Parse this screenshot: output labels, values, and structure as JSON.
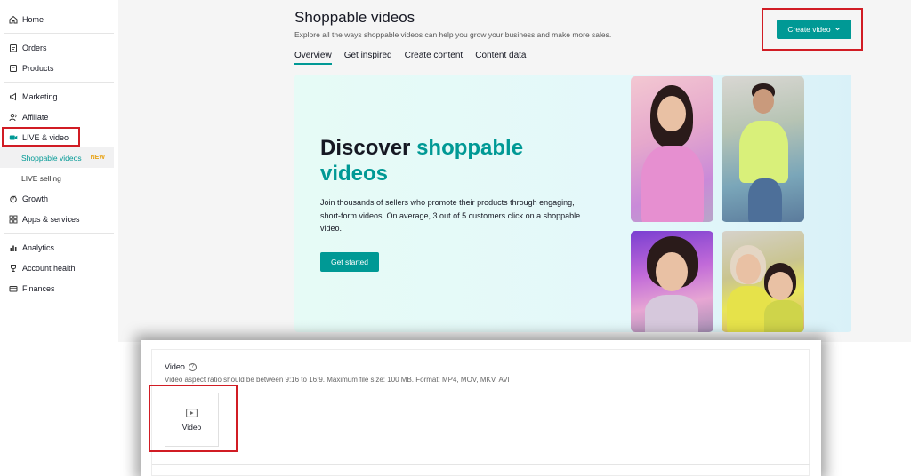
{
  "sidebar": {
    "items": [
      {
        "label": "Home",
        "icon": "home-icon"
      },
      {
        "label": "Orders",
        "icon": "clipboard-icon"
      },
      {
        "label": "Products",
        "icon": "box-icon"
      },
      {
        "label": "Marketing",
        "icon": "megaphone-icon"
      },
      {
        "label": "Affiliate",
        "icon": "people-icon"
      },
      {
        "label": "LIVE & video",
        "icon": "video-camera-icon"
      },
      {
        "label": "Growth",
        "icon": "sprout-icon"
      },
      {
        "label": "Apps & services",
        "icon": "grid-icon"
      },
      {
        "label": "Analytics",
        "icon": "bar-chart-icon"
      },
      {
        "label": "Account health",
        "icon": "trophy-icon"
      },
      {
        "label": "Finances",
        "icon": "wallet-icon"
      }
    ],
    "sub_items": [
      {
        "label": "Shoppable videos",
        "badge": "NEW",
        "active": true
      },
      {
        "label": "LIVE selling"
      }
    ]
  },
  "header": {
    "title": "Shoppable videos",
    "subtitle": "Explore all the ways shoppable videos can help you grow your business and make more sales.",
    "create_button": "Create video"
  },
  "tabs": [
    {
      "label": "Overview",
      "active": true
    },
    {
      "label": "Get inspired"
    },
    {
      "label": "Create content"
    },
    {
      "label": "Content data"
    }
  ],
  "hero": {
    "title_plain": "Discover",
    "title_accent": "shoppable videos",
    "body": "Join thousands of sellers who promote their products through engaging, short-form videos. On average, 3 out of 5 customers click on a shoppable video.",
    "cta": "Get started"
  },
  "upload": {
    "label": "Video",
    "hint": "Video aspect ratio should be between 9:16 to 16:9. Maximum file size: 100 MB. Format: MP4, MOV, MKV, AVI",
    "box_label": "Video"
  },
  "colors": {
    "accent": "#009995",
    "highlight_box": "#d11c24",
    "new_badge": "#e8a317"
  }
}
